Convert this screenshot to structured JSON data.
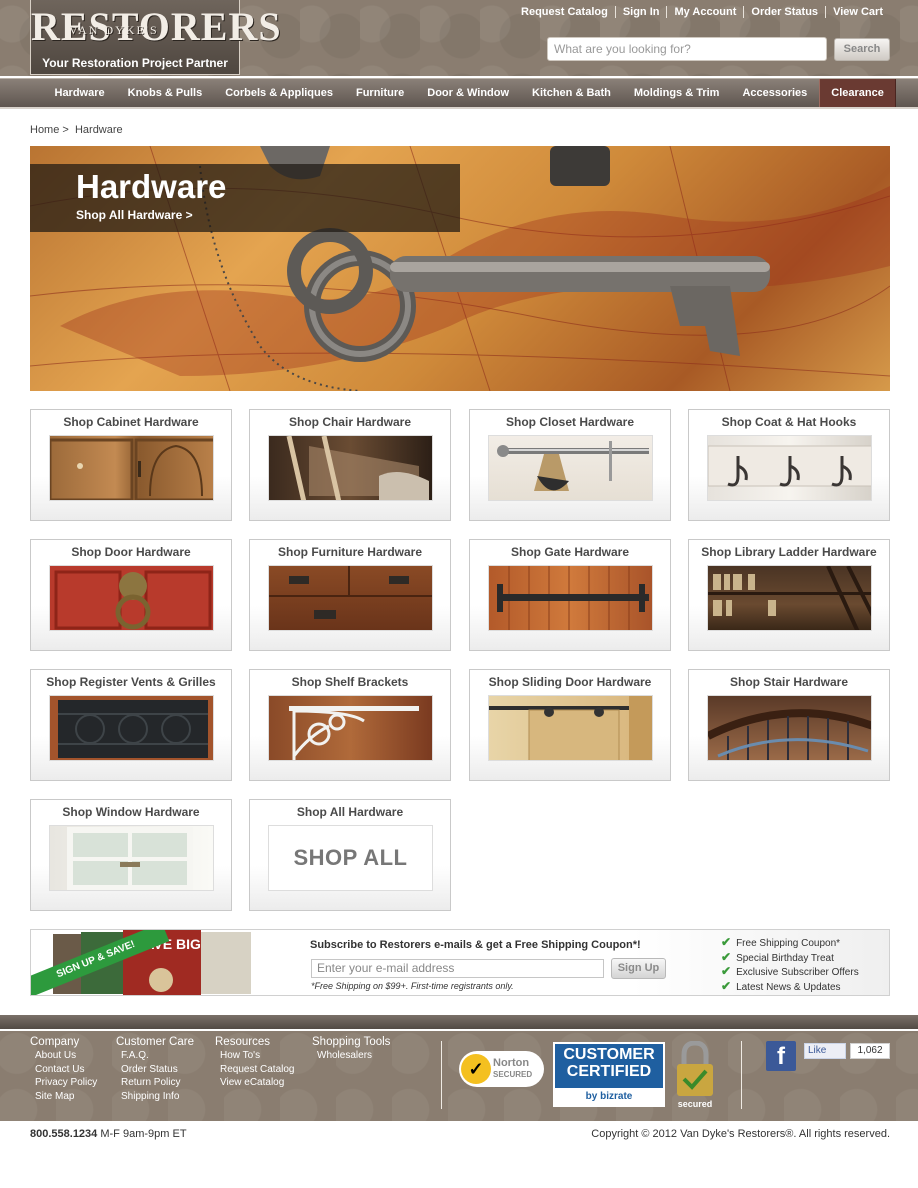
{
  "header": {
    "logo_small": "VAN DYKE'S",
    "logo_main": "RESTORERS",
    "logo_tagline": "Your Restoration Project Partner",
    "util_links": [
      "Request Catalog",
      "Sign In",
      "My Account",
      "Order Status",
      "View Cart"
    ],
    "search_placeholder": "What are you looking for?",
    "search_button": "Search"
  },
  "nav": {
    "items": [
      "Hardware",
      "Knobs & Pulls",
      "Corbels & Appliques",
      "Furniture",
      "Door & Window",
      "Kitchen & Bath",
      "Moldings & Trim",
      "Accessories",
      "Clearance"
    ]
  },
  "breadcrumb": {
    "home": "Home",
    "sep": ">",
    "current": "Hardware"
  },
  "hero": {
    "title": "Hardware",
    "link": "Shop All Hardware >"
  },
  "tiles": [
    {
      "label": "Shop Cabinet Hardware"
    },
    {
      "label": "Shop Chair Hardware"
    },
    {
      "label": "Shop Closet Hardware"
    },
    {
      "label": "Shop Coat & Hat Hooks"
    },
    {
      "label": "Shop Door Hardware"
    },
    {
      "label": "Shop Furniture Hardware"
    },
    {
      "label": "Shop Gate Hardware"
    },
    {
      "label": "Shop Library Ladder Hardware"
    },
    {
      "label": "Shop Register Vents & Grilles"
    },
    {
      "label": "Shop Shelf Brackets"
    },
    {
      "label": "Shop Sliding Door Hardware"
    },
    {
      "label": "Shop Stair Hardware"
    },
    {
      "label": "Shop Window Hardware"
    },
    {
      "label": "Shop All Hardware",
      "image_text": "SHOP ALL"
    }
  ],
  "subscribe": {
    "banner": "SIGN UP & SAVE!",
    "catalog_text": "SAVE BIG",
    "title": "Subscribe to Restorers e-mails & get a Free Shipping Coupon*!",
    "input_placeholder": "Enter your e-mail address",
    "button": "Sign Up",
    "note": "*Free Shipping on $99+. First-time registrants only.",
    "benefits": [
      "Free Shipping Coupon*",
      "Special Birthday Treat",
      "Exclusive Subscriber Offers",
      "Latest News & Updates"
    ]
  },
  "footer": {
    "columns": [
      {
        "heading": "Company",
        "links": [
          "About Us",
          "Contact Us",
          "Privacy Policy",
          "Site Map"
        ]
      },
      {
        "heading": "Customer Care",
        "links": [
          "F.A.Q.",
          "Order Status",
          "Return Policy",
          "Shipping Info"
        ]
      },
      {
        "heading": "Resources",
        "links": [
          "How To's",
          "Request Catalog",
          "View eCatalog"
        ]
      },
      {
        "heading": "Shopping Tools",
        "links": [
          "Wholesalers"
        ]
      }
    ],
    "norton": {
      "line1": "Norton",
      "line2": "SECURED"
    },
    "bizrate": {
      "line1": "CUSTOMER",
      "line2": "CERTIFIED",
      "by": "by bizrate"
    },
    "lock_label": "secured",
    "fb_like": "Like",
    "fb_count": "1,062",
    "phone": "800.558.1234",
    "hours": "M-F 9am-9pm ET",
    "copyright": "Copyright © 2012 Van Dyke's Restorers®. All rights reserved."
  }
}
